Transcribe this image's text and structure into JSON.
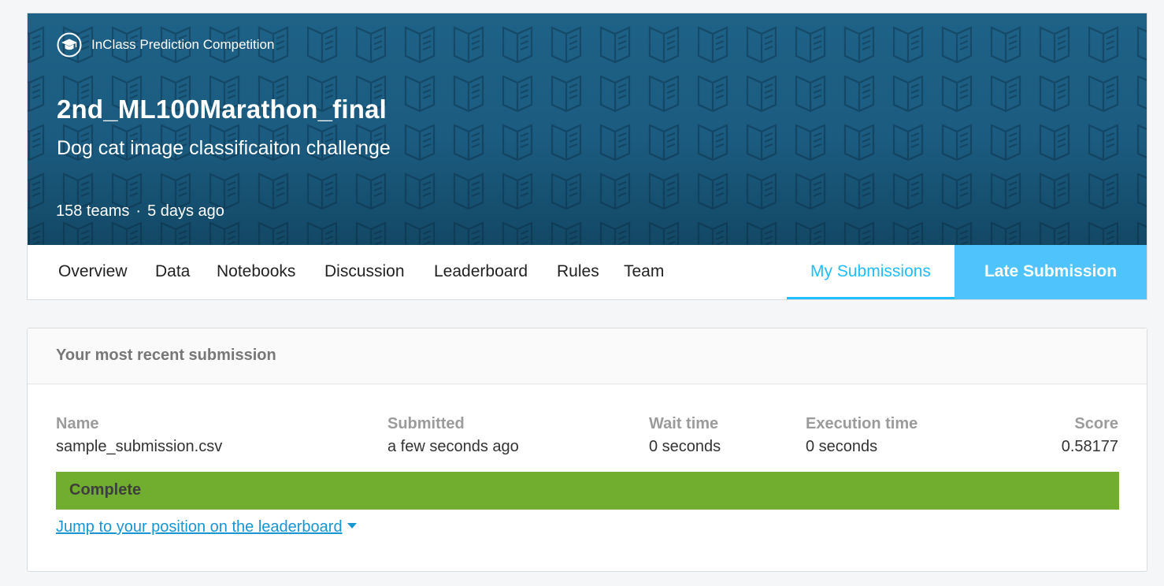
{
  "competition": {
    "type_label": "InClass Prediction Competition",
    "title": "2nd_ML100Marathon_final",
    "subtitle": "Dog cat image classificaiton challenge",
    "teams": "158 teams",
    "separator": "·",
    "age": "5 days ago",
    "banner_color": "#1b5b7f"
  },
  "tabs": [
    {
      "label": "Overview"
    },
    {
      "label": "Data"
    },
    {
      "label": "Notebooks"
    },
    {
      "label": "Discussion"
    },
    {
      "label": "Leaderboard"
    },
    {
      "label": "Rules"
    },
    {
      "label": "Team"
    }
  ],
  "active_tab": {
    "label": "My Submissions",
    "color": "#20beff"
  },
  "late_submission": {
    "label": "Late Submission",
    "color": "#4fc3fc"
  },
  "submission": {
    "header": "Your most recent submission",
    "columns": {
      "name": {
        "label": "Name",
        "value": "sample_submission.csv"
      },
      "submitted": {
        "label": "Submitted",
        "value": "a few seconds ago"
      },
      "wait": {
        "label": "Wait time",
        "value": "0 seconds"
      },
      "execution": {
        "label": "Execution time",
        "value": "0 seconds"
      },
      "score": {
        "label": "Score",
        "value": "0.58177"
      }
    },
    "status": "Complete",
    "status_color": "#71ad2e",
    "jump_link": "Jump to your position on the leaderboard"
  }
}
